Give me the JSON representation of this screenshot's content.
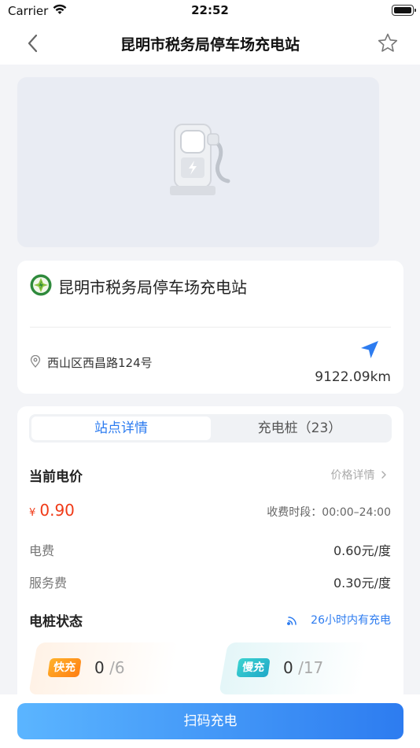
{
  "status_bar": {
    "carrier": "Carrier",
    "time": "22:52"
  },
  "nav": {
    "title": "昆明市税务局停车场充电站"
  },
  "station": {
    "name": "昆明市税务局停车场充电站",
    "address": "西山区西昌路124号",
    "distance": "9122.09km"
  },
  "tabs": [
    {
      "label": "站点详情",
      "active": true
    },
    {
      "label": "充电桩（23）",
      "active": false
    }
  ],
  "price": {
    "title": "当前电价",
    "detail_link": "价格详情",
    "currency": "¥",
    "value": "0.90",
    "time_range": "收费时段：00:00–24:00",
    "rows": [
      {
        "label": "电费",
        "value": "0.60元/度"
      },
      {
        "label": "服务费",
        "value": "0.30元/度"
      }
    ]
  },
  "pile_status": {
    "title": "电桩状态",
    "note": "26小时内有充电",
    "fast": {
      "label": "快充",
      "available": "0",
      "total": "/6"
    },
    "slow": {
      "label": "慢充",
      "available": "0",
      "total": "/17"
    }
  },
  "action": {
    "scan_label": "扫码充电"
  },
  "colors": {
    "accent": "#2d7cf0",
    "price": "#f03a17",
    "fast": "#ff8c1a",
    "slow": "#2cbfcf"
  }
}
